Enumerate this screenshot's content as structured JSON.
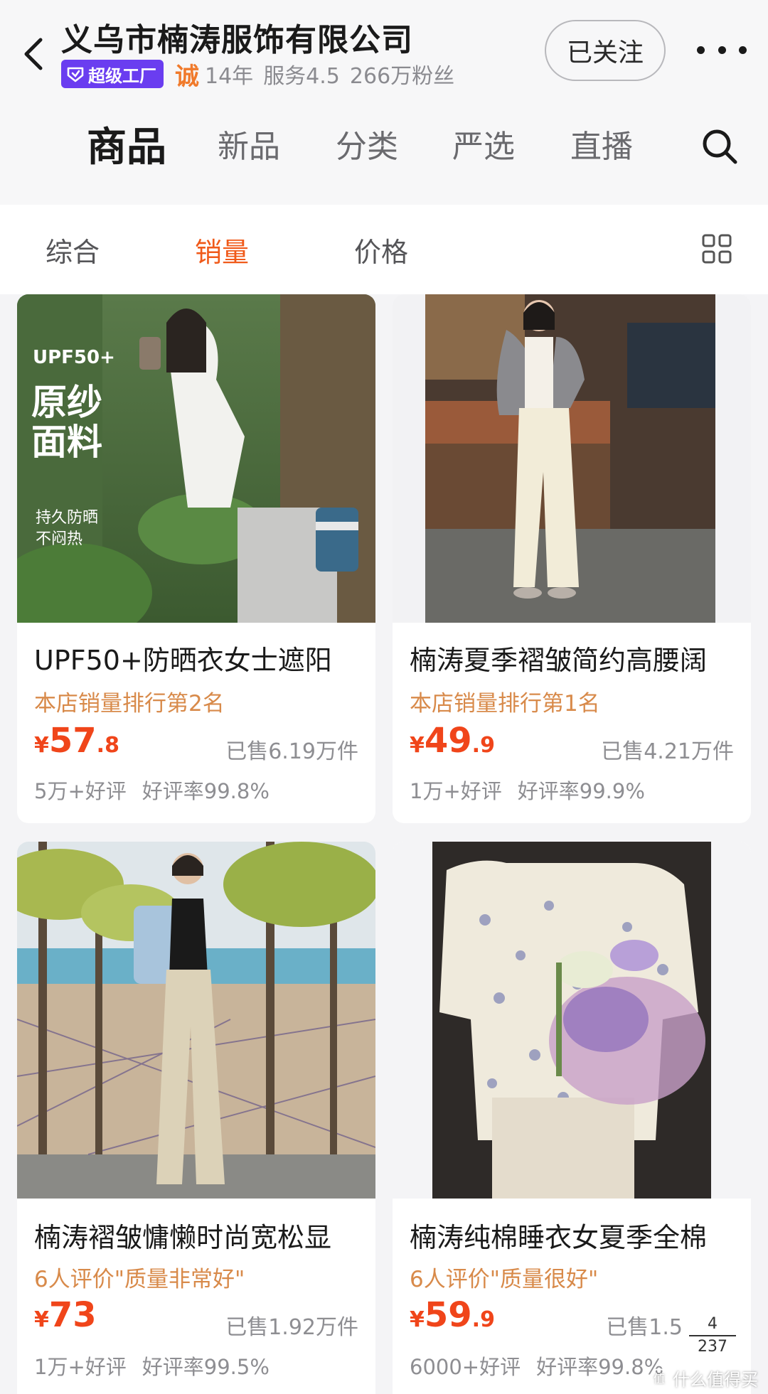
{
  "header": {
    "shop_name": "义乌市楠涛服饰有限公司",
    "super_factory_label": "超级工厂",
    "cheng_label": "诚",
    "years": "14年",
    "service": "服务4.5",
    "fans": "266万粉丝",
    "follow_label": "已关注"
  },
  "tabs": [
    {
      "label": "商品",
      "active": true
    },
    {
      "label": "新品"
    },
    {
      "label": "分类"
    },
    {
      "label": "严选"
    },
    {
      "label": "直播"
    }
  ],
  "sort": [
    {
      "label": "综合"
    },
    {
      "label": "销量",
      "active": true
    },
    {
      "label": "价格"
    }
  ],
  "products": [
    {
      "title": "UPF50+防晒衣女士遮阳",
      "tagline": "本店销量排行第2名",
      "price_symbol": "¥",
      "price_int": "57",
      "price_dec": ".8",
      "sold": "已售6.19万件",
      "good_reviews": "5万+好评",
      "rating": "好评率99.8%",
      "overlay": {
        "line1": "UPF50+",
        "line2": "原纱",
        "line3": "面料",
        "line4": "持久防晒",
        "line5": "不闷热"
      }
    },
    {
      "title": "楠涛夏季褶皱简约高腰阔",
      "tagline": "本店销量排行第1名",
      "price_symbol": "¥",
      "price_int": "49",
      "price_dec": ".9",
      "sold": "已售4.21万件",
      "good_reviews": "1万+好评",
      "rating": "好评率99.9%"
    },
    {
      "title": "楠涛褶皱慵懒时尚宽松显",
      "tagline": "6人评价\"质量非常好\"",
      "price_symbol": "¥",
      "price_int": "73",
      "price_dec": "",
      "sold": "已售1.92万件",
      "good_reviews": "1万+好评",
      "rating": "好评率99.5%"
    },
    {
      "title": "楠涛纯棉睡衣女夏季全棉",
      "tagline": "6人评价\"质量很好\"",
      "price_symbol": "¥",
      "price_int": "59",
      "price_dec": ".9",
      "sold": "已售1.5",
      "good_reviews": "6000+好评",
      "rating": "好评率99.8%"
    }
  ],
  "pager": {
    "current": "4",
    "total": "237"
  },
  "watermark": "什么值得买",
  "colors": {
    "accent": "#f05a1a",
    "price": "#f0451a",
    "tagline": "#d88a4a",
    "super_badge": "#6a3df0"
  }
}
